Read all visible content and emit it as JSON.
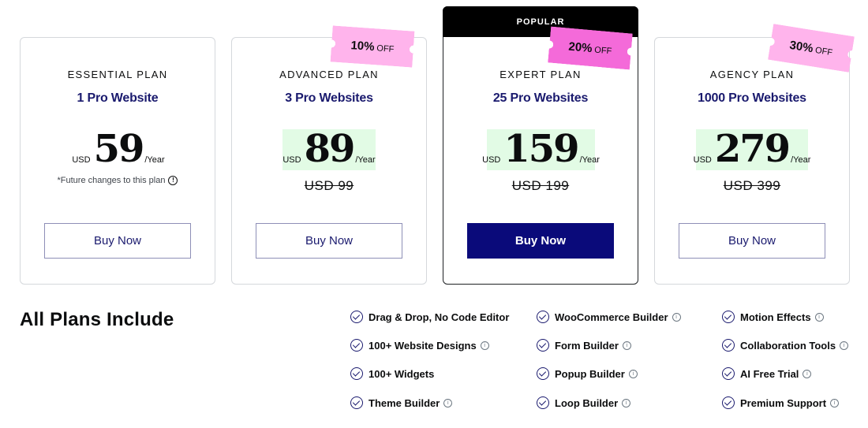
{
  "plans": [
    {
      "name": "ESSENTIAL PLAN",
      "sites": "1 Pro Website",
      "currency": "USD",
      "amount": "59",
      "period": "/Year",
      "old_price": "",
      "note": "*Future changes to this plan",
      "button": "Buy Now",
      "discount": "",
      "off": ""
    },
    {
      "name": "ADVANCED PLAN",
      "sites": "3 Pro Websites",
      "currency": "USD",
      "amount": "89",
      "period": "/Year",
      "old_price": "USD 99",
      "note": "",
      "button": "Buy Now",
      "discount": "10%",
      "off": "OFF"
    },
    {
      "name": "EXPERT PLAN",
      "sites": "25 Pro Websites",
      "currency": "USD",
      "amount": "159",
      "period": "/Year",
      "old_price": "USD 199",
      "note": "",
      "button": "Buy Now",
      "discount": "20%",
      "off": "OFF",
      "badge": "POPULAR"
    },
    {
      "name": "AGENCY PLAN",
      "sites": "1000 Pro Websites",
      "currency": "USD",
      "amount": "279",
      "period": "/Year",
      "old_price": "USD 399",
      "note": "",
      "button": "Buy Now",
      "discount": "30%",
      "off": "OFF"
    }
  ],
  "includes": {
    "title": "All Plans Include",
    "columns": [
      [
        {
          "label": "Drag & Drop, No Code Editor",
          "info": false
        },
        {
          "label": "100+ Website Designs",
          "info": true
        },
        {
          "label": "100+ Widgets",
          "info": false
        },
        {
          "label": "Theme Builder",
          "info": true
        }
      ],
      [
        {
          "label": "WooCommerce Builder",
          "info": true
        },
        {
          "label": "Form Builder",
          "info": true
        },
        {
          "label": "Popup Builder",
          "info": true
        },
        {
          "label": "Loop Builder",
          "info": true
        }
      ],
      [
        {
          "label": "Motion Effects",
          "info": true
        },
        {
          "label": "Collaboration Tools",
          "info": true
        },
        {
          "label": "AI Free Trial",
          "info": true
        },
        {
          "label": "Premium Support",
          "info": true
        }
      ]
    ]
  },
  "colors": {
    "accent": "#0a0a7a",
    "price_bg": "#e2fbe5",
    "ribbon": "#ffb4ec",
    "ribbon_hot": "#f46ad9"
  },
  "icons": {
    "check": "check-circle-icon",
    "info": "info-circle-icon"
  }
}
